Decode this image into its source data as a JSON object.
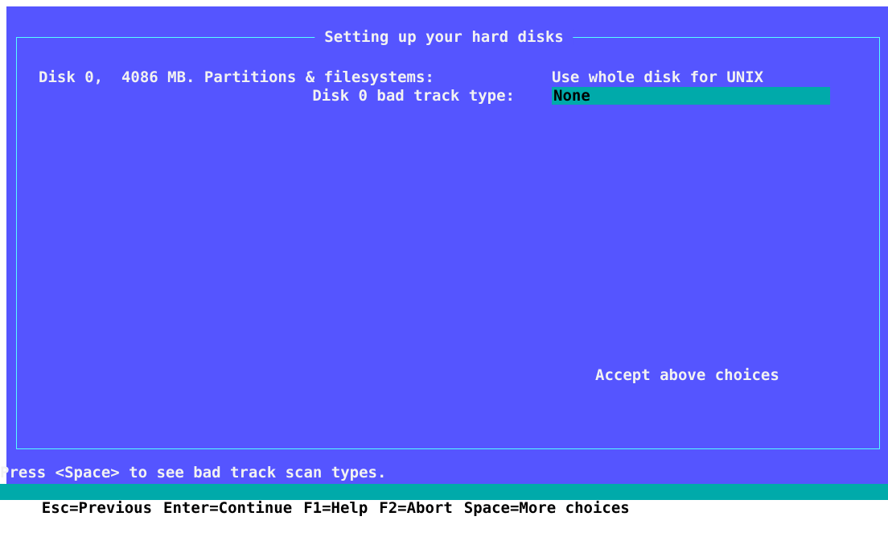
{
  "window": {
    "title": "Setting up your hard disks"
  },
  "fields": {
    "partitions_label": "Disk 0,  4086 MB. Partitions & filesystems:",
    "partitions_value": "Use whole disk for UNIX",
    "badtrack_label": "Disk 0 bad track type:",
    "badtrack_value": "None"
  },
  "accept": {
    "label": "Accept above choices"
  },
  "hint": {
    "text": "Press <Space> to see bad track scan types."
  },
  "statusbar": {
    "items": [
      "Esc=Previous",
      "Enter=Continue",
      "F1=Help",
      "F2=Abort",
      "Space=More choices"
    ]
  },
  "colors": {
    "background": "#5555ff",
    "text": "#f2f2f2",
    "highlight": "#00aaaa",
    "border": "#55ffff"
  }
}
